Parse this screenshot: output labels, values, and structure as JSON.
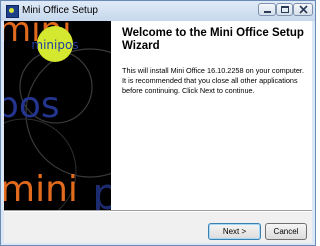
{
  "window": {
    "title": "Mini Office Setup"
  },
  "banner": {
    "logo_text": "mini",
    "logo_text_accent": "pos",
    "badge_text": "minipos",
    "colors": {
      "background": "#000000",
      "orange": "#e26a1d",
      "blue": "#23358f",
      "badge": "#d4e830"
    }
  },
  "content": {
    "heading": "Welcome to the Mini Office Setup Wizard",
    "body": "This will install Mini Office 16.10.2258 on your computer. It is recommended that you close all other applications before continuing. Click Next to continue."
  },
  "buttons": {
    "next": "Next >",
    "cancel": "Cancel"
  }
}
